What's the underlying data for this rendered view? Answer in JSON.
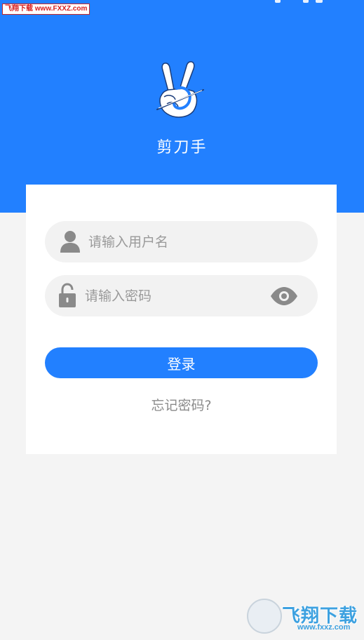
{
  "watermark_top": {
    "text": "飞翔下载 www.FXXZ.com"
  },
  "app": {
    "name": "剪刀手",
    "logo_icon": "victory-hand-icon"
  },
  "login": {
    "username_placeholder": "请输入用户名",
    "password_placeholder": "请输入密码",
    "login_label": "登录",
    "forgot_label": "忘记密码?"
  },
  "icons": {
    "user": "user-icon",
    "lock": "lock-icon",
    "eye": "eye-icon"
  },
  "watermark_bottom": {
    "title": "飞翔下载",
    "url": "www.fxxz.com"
  },
  "colors": {
    "primary": "#2280ff",
    "background": "#f4f4f4",
    "field": "#f2f2f2"
  }
}
